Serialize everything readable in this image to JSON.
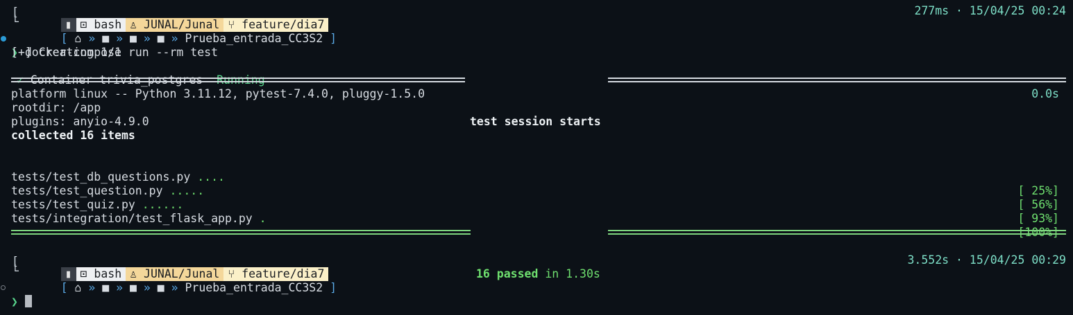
{
  "prompt1": {
    "win_icon": "▮",
    "shell_icon": "⊡",
    "shell": "bash",
    "user_icon": "♙",
    "user": "JUNAL/Junal",
    "git_icon": "⑂",
    "branch": "feature/dia7",
    "home_icon": "⌂",
    "folder_icon": "■",
    "chevron": "»",
    "dir": "Prueba_entrada_CC3S2",
    "duration": "277ms",
    "timestamp": "15/04/25 00:24"
  },
  "command": "docker-compose run --rm test",
  "creating": "[+] Creating 1/1",
  "container": {
    "check": "✓",
    "label": "Container trivia_postgres",
    "status": "Running",
    "time": "0.0s"
  },
  "session_header": "test session starts",
  "platform_line": "platform linux -- Python 3.11.12, pytest-7.4.0, pluggy-1.5.0",
  "rootdir_line": "rootdir: /app",
  "plugins_line": "plugins: anyio-4.9.0",
  "collected_line": "collected 16 items",
  "tests": [
    {
      "file": "tests/test_db_questions.py",
      "dots": "....",
      "pct": "[ 25%]"
    },
    {
      "file": "tests/test_question.py",
      "dots": ".....",
      "pct": "[ 56%]"
    },
    {
      "file": "tests/test_quiz.py",
      "dots": "......",
      "pct": "[ 93%]"
    },
    {
      "file": "tests/integration/test_flask_app.py",
      "dots": ".",
      "pct": "[100%]"
    }
  ],
  "summary": {
    "passed": "16 passed",
    "in": "in 1.30s"
  },
  "prompt2": {
    "duration": "3.552s",
    "timestamp": "15/04/25 00:29"
  },
  "prompt_symbol": "❯",
  "separator": "·",
  "colors": {
    "background": "#0c1117",
    "prompt_dot_active": "#2b9bd6",
    "prompt_dot_idle": "#7a8088",
    "pass_green": "#6fe06f"
  }
}
